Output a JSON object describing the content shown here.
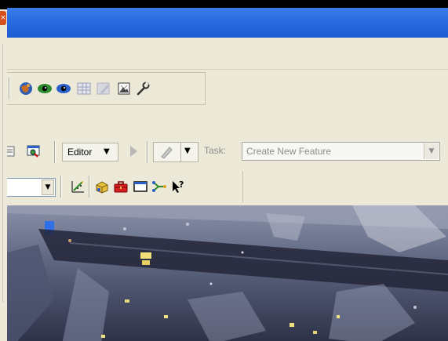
{
  "editor_toolbar": {
    "editor_label": "Editor",
    "task_label": "Task:",
    "task_value": "Create New Feature"
  },
  "icons": {
    "toolbar1": [
      "globe-icon",
      "green-eye-icon",
      "blue-eye-icon",
      "grid-table-icon",
      "disabled-pencil-icon",
      "image-frame-icon",
      "wrench-icon"
    ],
    "toolbar2": [
      "layer-icon",
      "zoom-map-icon",
      "sketch-arrow-icon",
      "pencil-icon"
    ],
    "toolbar3": [
      "chart-line-icon",
      "yellow-box-icon",
      "red-toolbox-icon",
      "window-icon",
      "network-icon",
      "help-pointer-icon"
    ]
  },
  "colors": {
    "titlebar": "#2b6ee2",
    "chrome": "#ece9d8",
    "disabled_text": "#8c8c8c"
  }
}
